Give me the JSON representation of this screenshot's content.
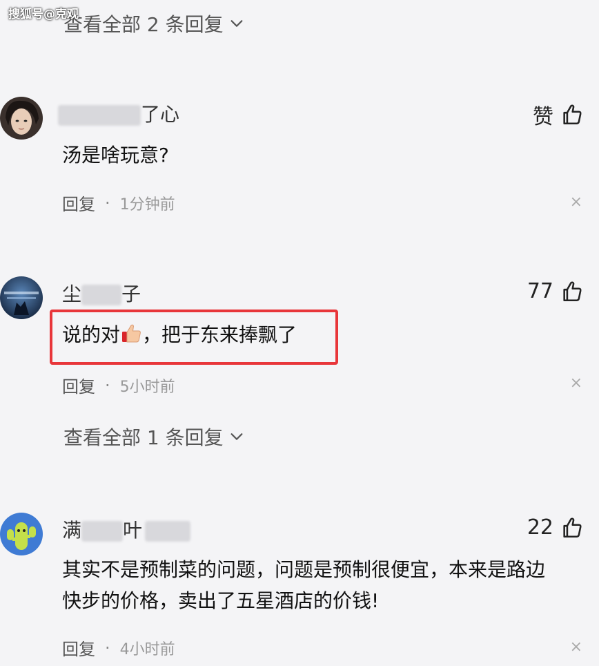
{
  "watermark": "搜狐号@克观",
  "top_view_more": "查看全部 2 条回复",
  "comments": [
    {
      "username_visible": "了心",
      "like_label": "赞",
      "content": "汤是啥玩意?",
      "reply": "回复",
      "dot": "·",
      "time": "1分钟前",
      "close": "×"
    },
    {
      "username_left": "尘",
      "username_right": "子",
      "like_label": "77",
      "content_before": "说的对",
      "content_after": "，把于东来捧飘了",
      "reply": "回复",
      "dot": "·",
      "time": "5小时前",
      "close": "×",
      "view_more": "查看全部 1 条回复"
    },
    {
      "username_left": "满",
      "username_mid": "叶",
      "like_label": "22",
      "content_line1": "其实不是预制菜的问题，问题是预制很便宜，本来是路边",
      "content_line2": "快步的价格，卖出了五星酒店的价钱!",
      "reply": "回复",
      "dot": "·",
      "time": "4小时前",
      "close": "×"
    }
  ],
  "colors": {
    "background": "#f4f4f6",
    "highlight_border": "#e8363a",
    "text": "#111111",
    "meta": "#555555"
  },
  "icons": [
    "chevron-down-icon",
    "thumbs-up-icon",
    "close-icon",
    "thumbs-up-emoji"
  ]
}
